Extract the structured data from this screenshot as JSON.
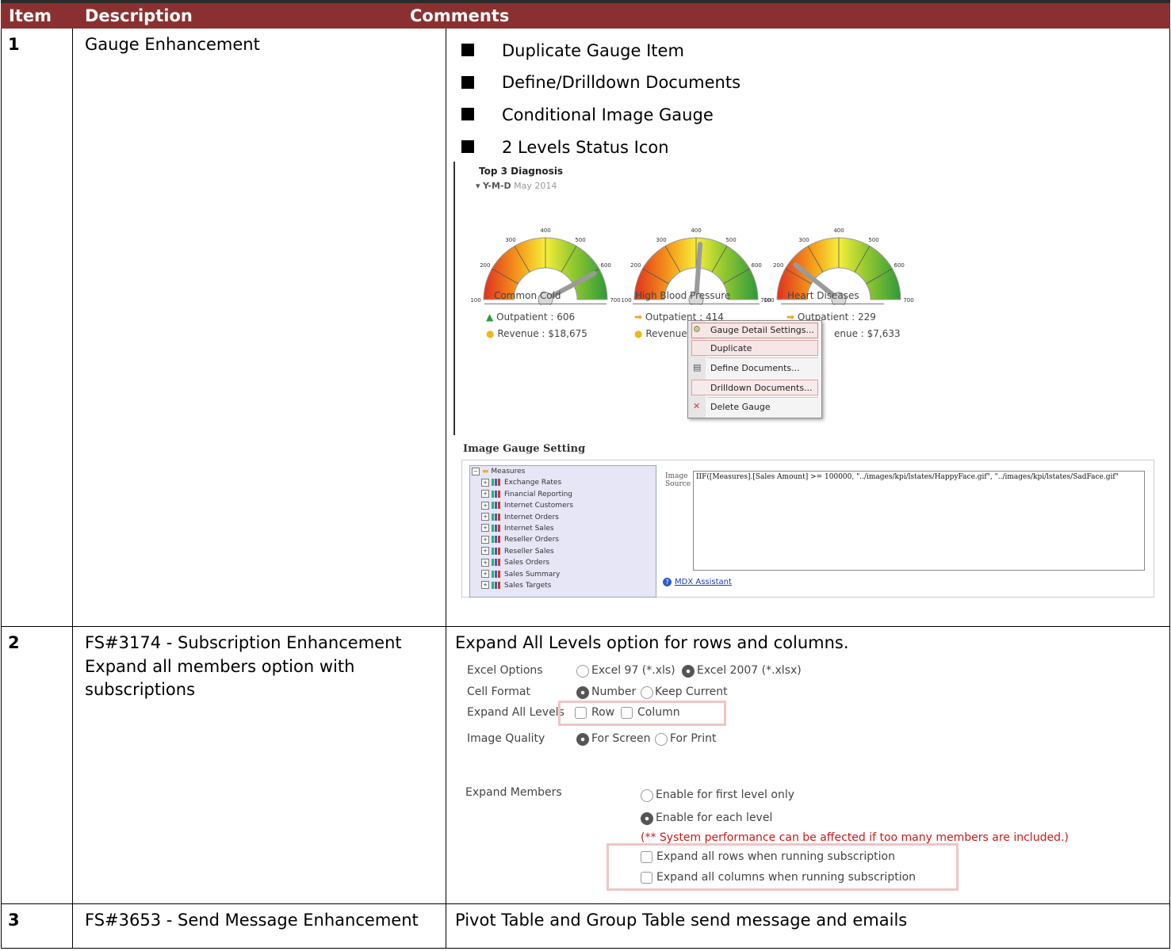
{
  "table": {
    "headers": {
      "item": "Item",
      "description": "Description",
      "comments": "Comments"
    },
    "rows": [
      {
        "item": "1",
        "description": "Gauge Enhancement",
        "bullets": [
          "Duplicate Gauge Item",
          "Define/Drilldown Documents",
          "Conditional Image Gauge",
          "2 Levels Status Icon"
        ]
      },
      {
        "item": "2",
        "description_line1": "FS#3174 - Subscription Enhancement",
        "description_line2": "Expand all members option with",
        "description_line3": "subscriptions",
        "comment": "Expand All Levels option for rows and columns."
      },
      {
        "item": "3",
        "description": "FS#3653 - Send Message Enhancement",
        "comment": "Pivot Table and Group Table send message and emails"
      }
    ]
  },
  "gauges": {
    "title": "Top 3 Diagnosis",
    "period_label": "Y-M-D",
    "period_value": "May 2014",
    "ticks": [
      "100",
      "200",
      "300",
      "400",
      "500",
      "600",
      "700"
    ],
    "items": [
      {
        "name": "Common Cold",
        "value": 606,
        "outpatient": "Outpatient : 606",
        "revenue": "Revenue : $18,675",
        "arrow": "up",
        "arrow_color": "#2e9a3a"
      },
      {
        "name": "High Blood Pressure",
        "value": 414,
        "outpatient": "Outpatient : 414",
        "revenue": "Revenue",
        "arrow": "right",
        "arrow_color": "#f0a41c"
      },
      {
        "name": "Heart Diseases",
        "value": 229,
        "outpatient": "Outpatient : 229",
        "revenue": "enue : $7,633",
        "arrow": "right",
        "arrow_color": "#f0a41c"
      }
    ]
  },
  "context_menu": {
    "items": [
      "Gauge Detail Settings...",
      "Duplicate",
      "Define Documents...",
      "Drilldown Documents...",
      "Delete Gauge"
    ]
  },
  "image_gauge_setting": {
    "title": "Image Gauge Setting",
    "tree": [
      "Measures",
      "Exchange Rates",
      "Financial Reporting",
      "Internet Customers",
      "Internet Orders",
      "Internet Sales",
      "Reseller Orders",
      "Reseller Sales",
      "Sales Orders",
      "Sales Summary",
      "Sales Targets"
    ],
    "source_label_1": "Image",
    "source_label_2": "Source",
    "source_text": "IIF([Measures].[Sales Amount] >= 100000, \"../images/kpi/lstates/HappyFace.gif\", \"../images/kpi/lstates/SadFace.gif\"",
    "mdx_link": "MDX Assistant"
  },
  "subscription_options": {
    "excel_options_label": "Excel Options",
    "excel97": "Excel 97 (*.xls)",
    "excel2007": "Excel 2007 (*.xlsx)",
    "cell_format_label": "Cell Format",
    "number": "Number",
    "keep_current": "Keep Current",
    "expand_all_levels_label": "Expand All Levels",
    "row": "Row",
    "column": "Column",
    "image_quality_label": "Image Quality",
    "for_screen": "For Screen",
    "for_print": "For Print",
    "expand_members_label": "Expand Members",
    "first_level": "Enable for first level only",
    "each_level": "Enable for each level",
    "warning": "(** System performance can be affected if too many members are included.)",
    "expand_rows": "Expand all rows when running subscription",
    "expand_columns": "Expand all columns when running subscription"
  },
  "colors": {
    "header_bg": "#8b3030",
    "warning": "#d01818",
    "link": "#1c3fa8"
  }
}
